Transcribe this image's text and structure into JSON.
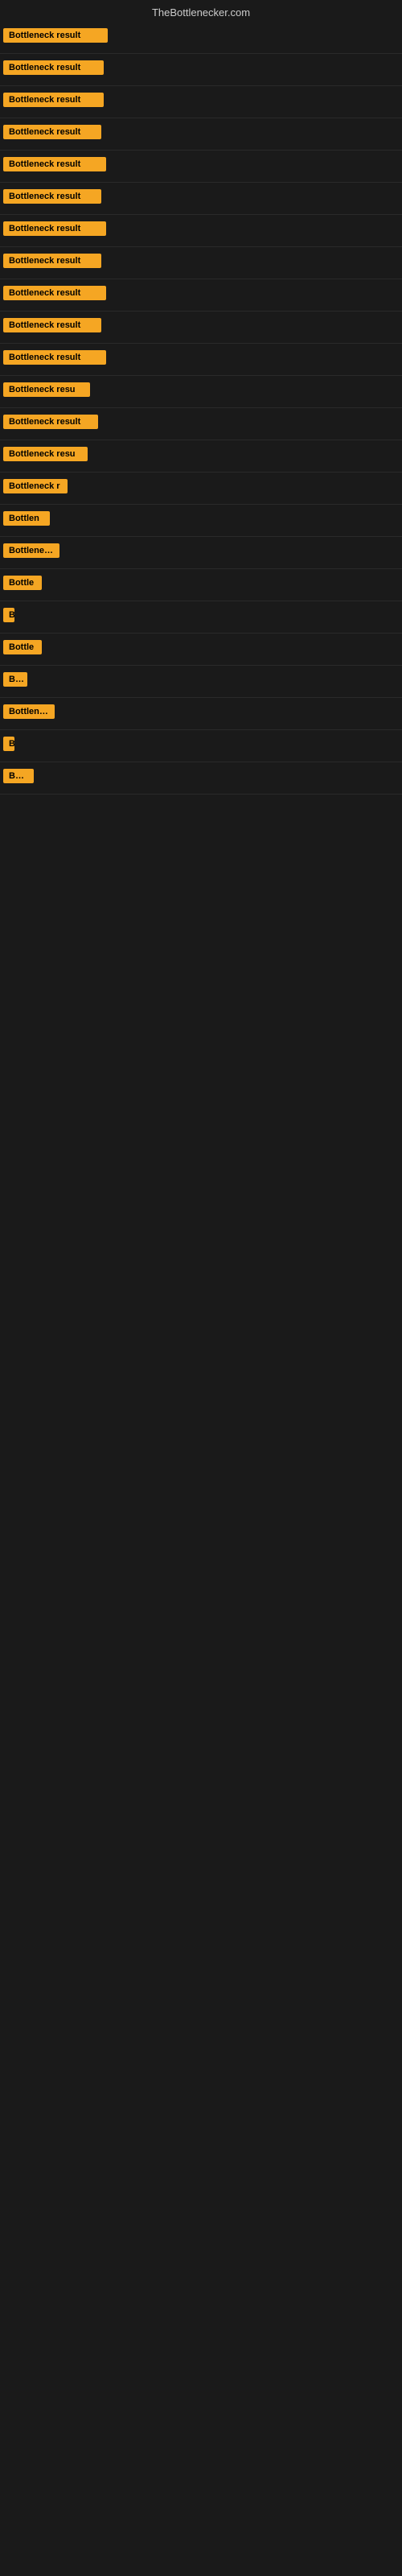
{
  "header": {
    "title": "TheBottlenecker.com"
  },
  "items": [
    {
      "label": "Bottleneck result",
      "width": 130
    },
    {
      "label": "Bottleneck result",
      "width": 125
    },
    {
      "label": "Bottleneck result",
      "width": 125
    },
    {
      "label": "Bottleneck result",
      "width": 122
    },
    {
      "label": "Bottleneck result",
      "width": 128
    },
    {
      "label": "Bottleneck result",
      "width": 122
    },
    {
      "label": "Bottleneck result",
      "width": 128
    },
    {
      "label": "Bottleneck result",
      "width": 122
    },
    {
      "label": "Bottleneck result",
      "width": 128
    },
    {
      "label": "Bottleneck result",
      "width": 122
    },
    {
      "label": "Bottleneck result",
      "width": 128
    },
    {
      "label": "Bottleneck resu",
      "width": 108
    },
    {
      "label": "Bottleneck result",
      "width": 118
    },
    {
      "label": "Bottleneck resu",
      "width": 105
    },
    {
      "label": "Bottleneck r",
      "width": 80
    },
    {
      "label": "Bottlen",
      "width": 58
    },
    {
      "label": "Bottleneck",
      "width": 70
    },
    {
      "label": "Bottle",
      "width": 48
    },
    {
      "label": "B",
      "width": 14
    },
    {
      "label": "Bottle",
      "width": 48
    },
    {
      "label": "Bot",
      "width": 30
    },
    {
      "label": "Bottlenec",
      "width": 64
    },
    {
      "label": "B",
      "width": 12
    },
    {
      "label": "Bottl",
      "width": 38
    }
  ]
}
